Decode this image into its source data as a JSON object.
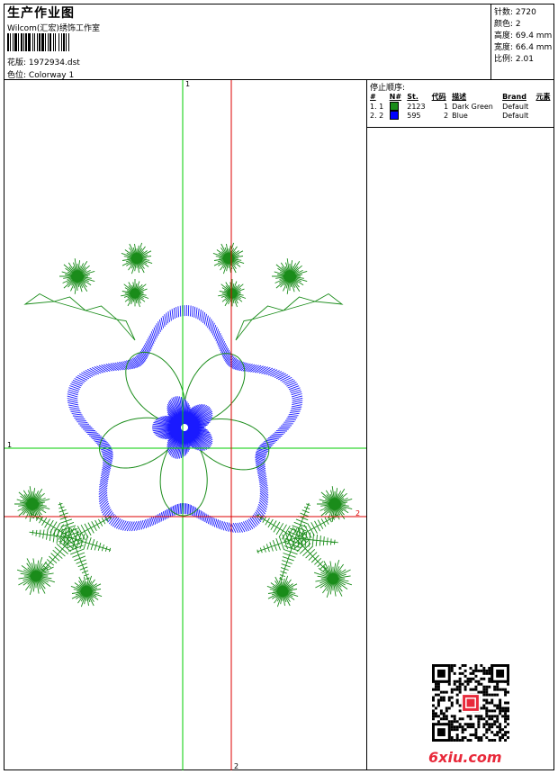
{
  "header": {
    "title": "生产作业图",
    "subtitle": "Wilcom(汇宏)绣饰工作室",
    "design_file_label": "花版:",
    "design_file": "1972934.dst",
    "colorway_label": "色位:",
    "colorway": "Colorway 1"
  },
  "stats": {
    "stitches": "针数: 2720",
    "colors": "颜色: 2",
    "height": "高度: 69.4 mm",
    "width": "宽度: 66.4 mm",
    "scale": "比例: 2.01"
  },
  "axes": {
    "top_label": "1",
    "left_label": "1",
    "right_label": "2",
    "bottom_label": "2"
  },
  "stops": {
    "title": "停止顺序:",
    "headers": [
      "#",
      "N#",
      "St.",
      "代码",
      "描述",
      "Brand",
      "元素"
    ],
    "rows": [
      {
        "idx": "1. 1",
        "color": "#1a8c1a",
        "st": "2123",
        "code": "1",
        "desc": "Dark Green",
        "brand": "Default"
      },
      {
        "idx": "2. 2",
        "color": "#0000ff",
        "st": "595",
        "code": "2",
        "desc": "Blue",
        "brand": "Default"
      }
    ]
  },
  "colors": {
    "green": "#1a8c1a",
    "blue": "#1a1aff",
    "axis_green": "#00cc00",
    "axis_red": "#dd0000"
  },
  "watermark": "6xiu.com"
}
